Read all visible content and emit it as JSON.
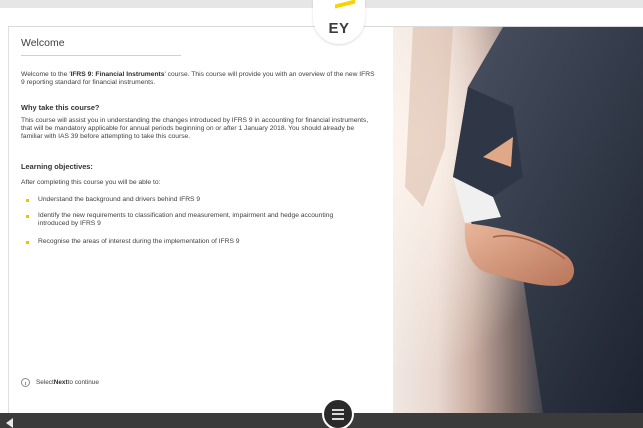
{
  "logo": {
    "text": "EY"
  },
  "content": {
    "title": "Welcome",
    "intro": {
      "before": "Welcome to the '",
      "course": "IFRS 9: Financial Instruments",
      "after": "' course. This course will provide you with an overview of the new IFRS 9 reporting standard for financial instruments."
    },
    "why_heading": "Why take this course?",
    "why_body": "This course will assist you in understanding the changes introduced by IFRS 9 in accounting for financial instruments, that will be mandatory applicable for annual periods beginning on or after 1 January 2018. You should already be familiar with IAS 39 before attempting to take this course.",
    "objectives_heading": "Learning objectives:",
    "after_text": "After completing this course you will be able to:",
    "objectives": [
      "Understand the background and drivers behind IFRS 9",
      "Identify the new requirements to classification and measurement, impairment and hedge accounting introduced by IFRS 9",
      "Recognise the areas of interest during the implementation of IFRS 9"
    ],
    "next_hint": {
      "before": "Select ",
      "bold": "Next",
      "after": " to continue"
    }
  },
  "colors": {
    "bullet": "#f2c200",
    "bar": "#3b3b3b",
    "logo_beam": "#f6d400"
  },
  "icons": {
    "info": "info-circle-icon",
    "back": "back-arrow-icon",
    "menu": "menu-icon"
  }
}
